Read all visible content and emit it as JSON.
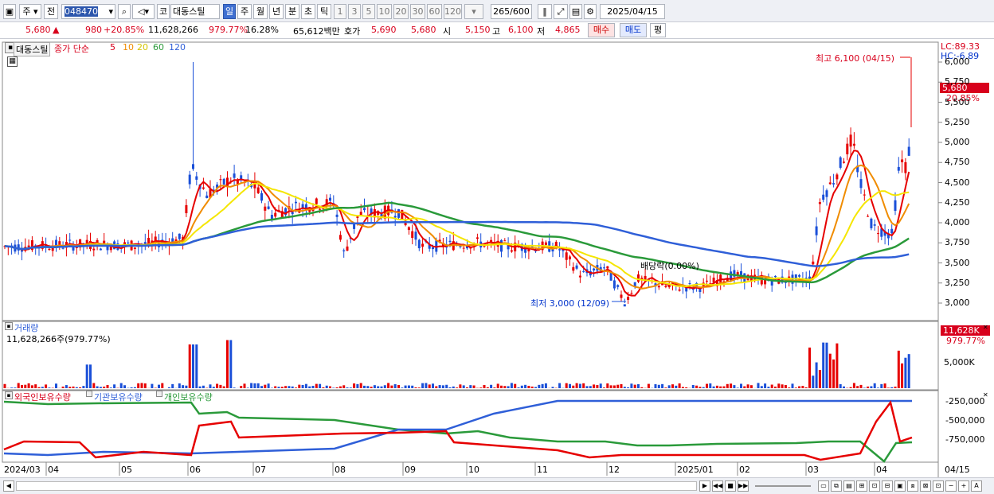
{
  "toolbar": {
    "market_type": "주",
    "prev_label": "전",
    "code": "048470",
    "kospi_label": "코",
    "stock_name": "대동스틸",
    "periods": [
      "일",
      "주",
      "월",
      "년",
      "분",
      "초",
      "틱"
    ],
    "intervals": [
      "1",
      "3",
      "5",
      "10",
      "20",
      "30",
      "60",
      "120"
    ],
    "count": "265",
    "count_total": "/600",
    "date": "2025/04/15"
  },
  "quote": {
    "price": "5,680",
    "change": "980",
    "change_pct": "+20.85%",
    "volume": "11,628,266",
    "volume_ratio": "979.77%",
    "turnover": "16.28%",
    "amount": "65,612백만",
    "ask_label": "호가",
    "ask": "5,690",
    "bid": "5,680",
    "open_label": "시",
    "open": "5,150",
    "high_label": "고",
    "high": "6,100",
    "low_label": "저",
    "low": "4,865",
    "buy_label": "매수",
    "sell_label": "매도",
    "eval_label": "평"
  },
  "legend": {
    "stock": "대동스틸",
    "ma_title": "종가 단순",
    "ma5": "5",
    "ma10": "10",
    "ma20": "20",
    "ma60": "60",
    "ma120": "120"
  },
  "price_axis": {
    "ticks": [
      "6,000",
      "5,750",
      "5,500",
      "5,250",
      "5,000",
      "4,750",
      "4,500",
      "4,250",
      "4,000",
      "3,750",
      "3,500",
      "3,250",
      "3,000"
    ],
    "lc": "LC:89.33",
    "hc": "HC:-6.89",
    "current": "5,680",
    "current_pct": "20.85%"
  },
  "annotations": {
    "high": "최고 6,100 (04/15)",
    "low": "최저 3,000 (12/09)",
    "dividend": "배당락(0.00%)"
  },
  "volume_panel": {
    "title": "거래량",
    "value": "11,628,266주(979.77%)",
    "axis": [
      "5,000K"
    ],
    "current": "11,628K",
    "current_pct": "979.77%"
  },
  "holdings_panel": {
    "series": [
      "외국인보유수량",
      "기관보유수량",
      "개인보유수량"
    ],
    "axis": [
      "-250,000",
      "-500,000",
      "-750,000"
    ]
  },
  "x_axis": [
    "2024/03",
    "04",
    "05",
    "06",
    "07",
    "08",
    "09",
    "10",
    "11",
    "12",
    "2025/01",
    "02",
    "03",
    "04",
    "04/15"
  ],
  "colors": {
    "up": "#e60000",
    "down": "#1a4fd8",
    "ma5": "#e60000",
    "ma10": "#f08c00",
    "ma20": "#f5e600",
    "ma60": "#2a9a3a",
    "ma120": "#2f5fd8"
  },
  "chart_data": {
    "type": "candlestick",
    "high": 6100,
    "high_date": "04/15",
    "low": 3000,
    "low_date": "12/09",
    "last": 5680,
    "ylim": [
      2950,
      6050
    ]
  }
}
